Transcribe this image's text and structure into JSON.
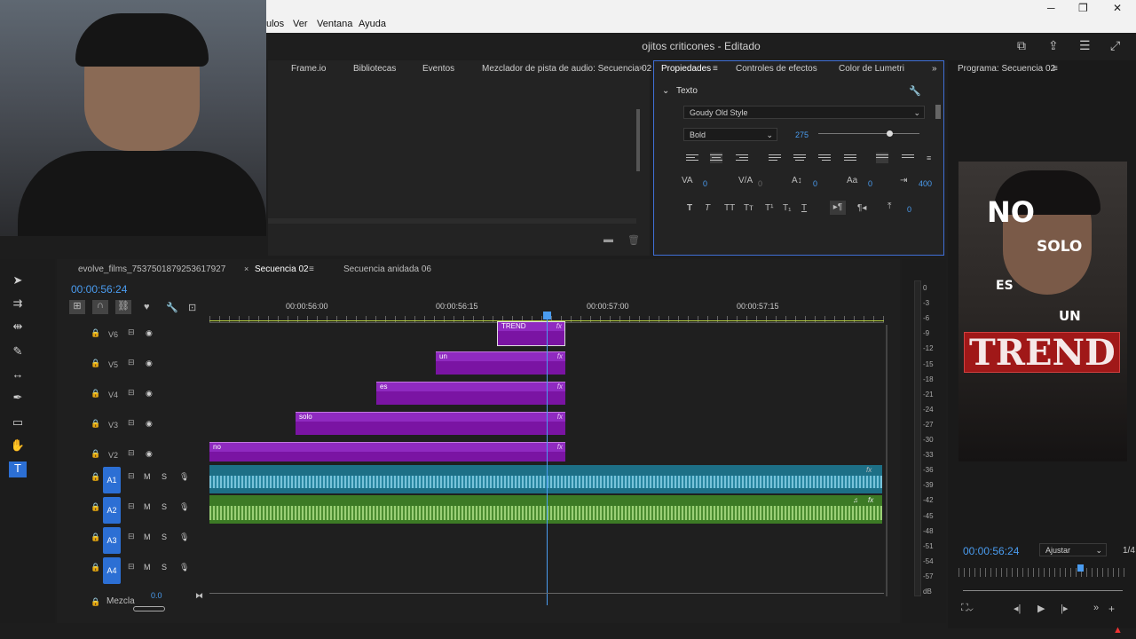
{
  "menu": [
    "ulos",
    "Ver",
    "Ventana",
    "Ayuda"
  ],
  "window": {
    "title": "ojitos criticones - Editado"
  },
  "top_tabs": [
    "Frame.io",
    "Bibliotecas",
    "Eventos",
    "Mezclador de pista de audio: Secuencia 02"
  ],
  "props_tabs": [
    "Propiedades",
    "Controles de efectos",
    "Color de Lumetri"
  ],
  "props": {
    "section": "Texto",
    "font": "Goudy Old Style",
    "style": "Bold",
    "size": "275",
    "kerning": "0",
    "tracking": "0",
    "leading": "0",
    "baseline": "0",
    "tsume": "400",
    "shadow": "0"
  },
  "program": {
    "title": "Programa: Secuencia 02",
    "timecode": "00:00:56:24",
    "fit": "Ajustar",
    "ratio": "1/4"
  },
  "video_text": [
    "NO",
    "SOLO",
    "ES",
    "UN",
    "TREND"
  ],
  "seq_tabs": [
    "evolve_films_7537501879253617927",
    "Secuencia 02",
    "Secuencia anidada 06"
  ],
  "timeline": {
    "timecode": "00:00:56:24",
    "ruler": [
      "00:00:56:00",
      "00:00:56:15",
      "00:00:57:00",
      "00:00:57:15"
    ],
    "video_tracks": [
      "V6",
      "V5",
      "V4",
      "V3",
      "V2"
    ],
    "audio_tracks": [
      "A1",
      "A2",
      "A3",
      "A4"
    ],
    "clips": [
      "TREND",
      "un",
      "es",
      "solo",
      "no"
    ],
    "mix_label": "Mezcla",
    "mix_value": "0.0"
  },
  "meter": [
    "0",
    "-3",
    "-6",
    "-9",
    "-12",
    "-15",
    "-18",
    "-21",
    "-24",
    "-27",
    "-30",
    "-33",
    "-36",
    "-39",
    "-42",
    "-45",
    "-48",
    "-51",
    "-54",
    "-57",
    "dB"
  ],
  "colors": {
    "accent": "#4a9cf0",
    "clip": "#7a14a3",
    "audio_blue": "#1d6f86",
    "audio_green": "#3c7a25"
  }
}
